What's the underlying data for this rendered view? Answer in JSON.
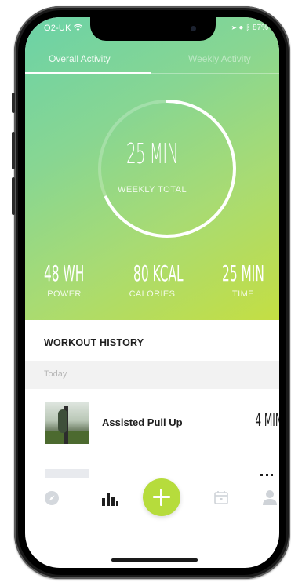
{
  "status_bar": {
    "carrier": "O2-UK",
    "battery": "87%"
  },
  "tabs": [
    {
      "label": "Overall Activity"
    },
    {
      "label": "Weekly Activity"
    }
  ],
  "ring": {
    "value": "25 MIN",
    "label": "WEEKLY TOTAL",
    "progress": 0.68
  },
  "stats": [
    {
      "value": "48 WH",
      "label": "POWER"
    },
    {
      "value": "80 KCAL",
      "label": "CALORIES"
    },
    {
      "value": "25 MIN",
      "label": "TIME"
    }
  ],
  "history": {
    "title": "WORKOUT HISTORY",
    "day_label": "Today",
    "items": [
      {
        "name": "Assisted Pull Up",
        "duration": "4 MIN"
      }
    ]
  },
  "nav": {
    "items": [
      "compass-icon",
      "bar-chart-icon",
      "add-icon",
      "calendar-icon",
      "profile-icon"
    ],
    "active": "bar-chart-icon",
    "accent": "#b6dc3c"
  }
}
